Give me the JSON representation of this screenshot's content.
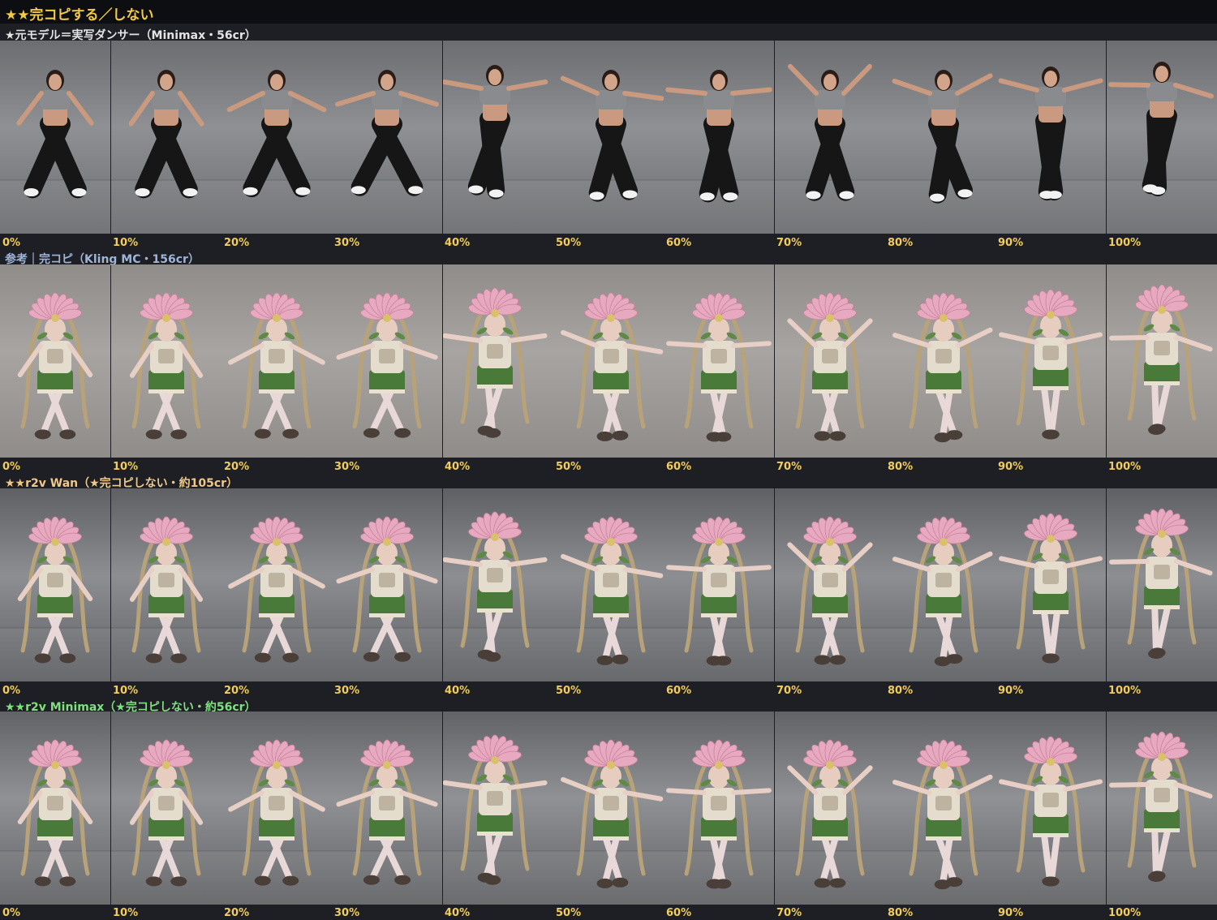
{
  "page": {
    "title": "★★完コピする／しない"
  },
  "rows": [
    {
      "label": "★元モデル＝実写ダンサー（Minimax・56cr）",
      "label_color": "#e3e3e3",
      "style": "real",
      "bg_light": "#8f9093",
      "bg_dark": "#6c6d70"
    },
    {
      "label": "参考｜完コピ（Kling MC・156cr）",
      "label_color": "#9fb5d8",
      "style": "plain",
      "bg_light": "#a7a4a2",
      "bg_dark": "#8f8c8a"
    },
    {
      "label": "★★r2v Wan（★完コピしない・約105cr）",
      "label_color": "#f0c98a",
      "style": "studio",
      "bg_light": "#8c8e92",
      "bg_dark": "#5e6064"
    },
    {
      "label": "★★r2v Minimax（★完コピしない・約56cr）",
      "label_color": "#7fe07f",
      "style": "studio",
      "bg_light": "#909194",
      "bg_dark": "#626366"
    }
  ],
  "progress": [
    "0%",
    "10%",
    "20%",
    "30%",
    "40%",
    "50%",
    "60%",
    "70%",
    "80%",
    "90%",
    "100%"
  ],
  "colors": {
    "title": "#f3c94a",
    "percent": "#f2cd5b",
    "shirt_real": "#8a8b8e",
    "pants_real": "#161616",
    "shirt_character": "#e4dccc",
    "shorts_character": "#4a7a3a",
    "petal": "#e7a9c0"
  }
}
